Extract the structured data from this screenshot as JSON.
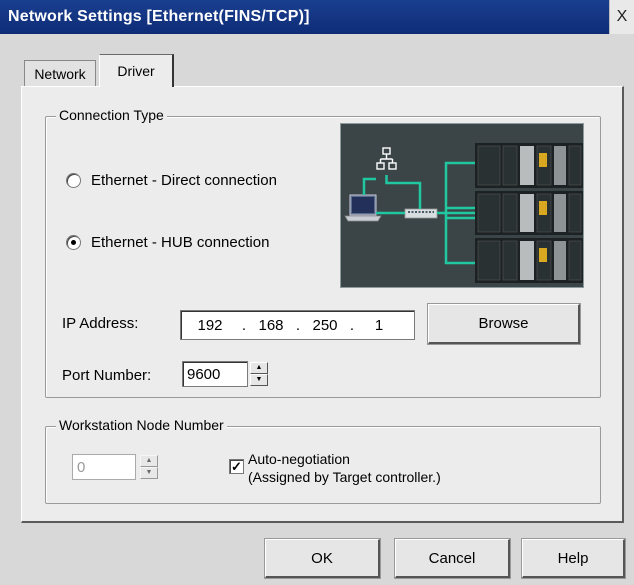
{
  "window": {
    "title": "Network Settings [Ethernet(FINS/TCP)]",
    "close_label": "X"
  },
  "tabs": [
    {
      "label": "Network",
      "active": false
    },
    {
      "label": "Driver",
      "active": true
    }
  ],
  "connection_type": {
    "group_title": "Connection Type",
    "options": [
      {
        "label": "Ethernet - Direct connection",
        "selected": false
      },
      {
        "label": "Ethernet - HUB connection",
        "selected": true
      }
    ],
    "diagram_icon": "network-hub-illustration"
  },
  "ip_address": {
    "label": "IP Address:",
    "octets": [
      "192",
      "168",
      "250",
      "1"
    ]
  },
  "browse_label": "Browse",
  "port": {
    "label": "Port Number:",
    "value": "9600"
  },
  "workstation": {
    "group_title": "Workstation Node Number",
    "value": "0",
    "auto_label": "Auto-negotiation",
    "auto_sub": "(Assigned by Target controller.)",
    "auto_checked": true
  },
  "footer": {
    "ok": "OK",
    "cancel": "Cancel",
    "help": "Help"
  },
  "colors": {
    "title_bar": "#0e2c77",
    "diagram_bg": "#3b4547",
    "link_color": "#21c7a0"
  }
}
